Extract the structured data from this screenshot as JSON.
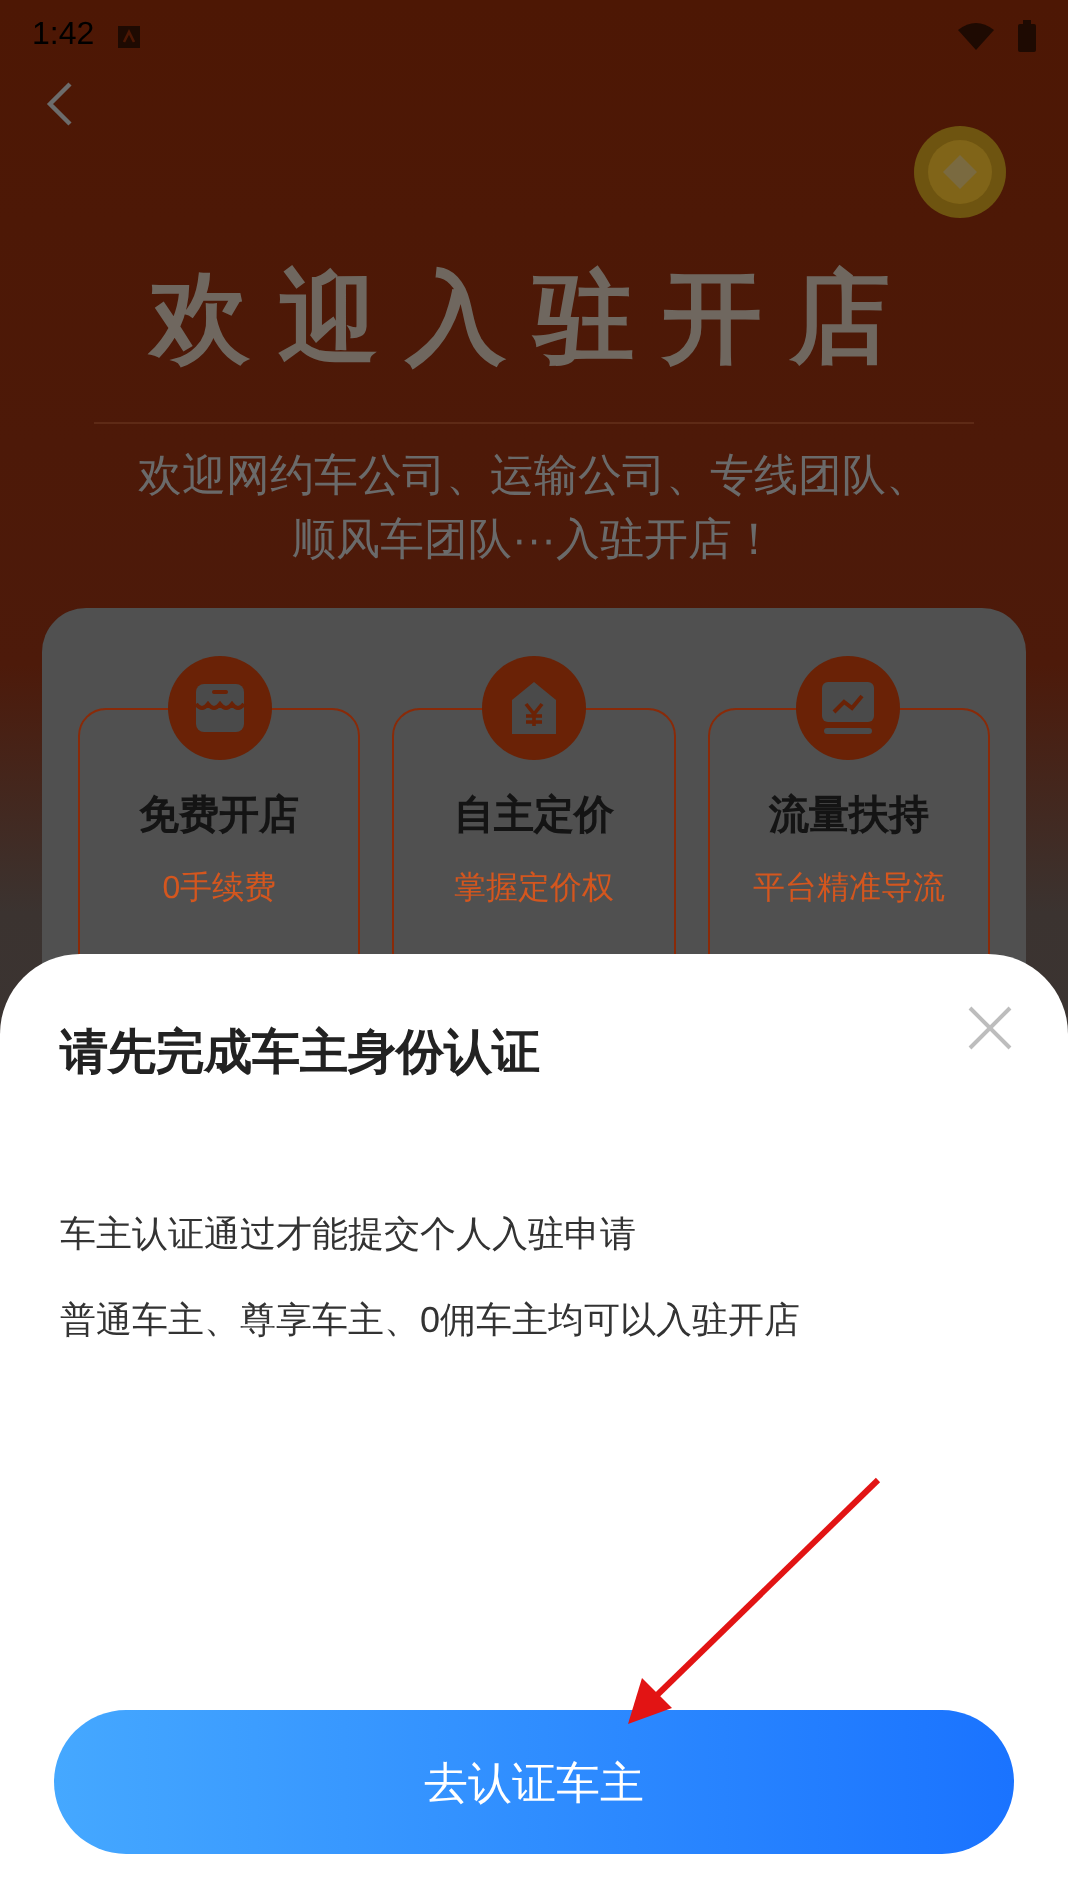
{
  "status_bar": {
    "time": "1:42"
  },
  "hero": {
    "title": "欢迎入驻开店",
    "subtitle_lines": [
      "欢迎网约车公司、运输公司、专线团队、",
      "顺风车团队···入驻开店！"
    ]
  },
  "features": [
    {
      "kind": "store",
      "title": "免费开店",
      "desc": "0手续费"
    },
    {
      "kind": "price",
      "title": "自主定价",
      "desc": "掌握定价权"
    },
    {
      "kind": "chart",
      "title": "流量扶持",
      "desc": "平台精准导流"
    }
  ],
  "dialog": {
    "title": "请先完成车主身份认证",
    "lines": [
      "车主认证通过才能提交个人入驻申请",
      "普通车主、尊享车主、0佣车主均可以入驻开店"
    ],
    "button": "去认证车主"
  }
}
